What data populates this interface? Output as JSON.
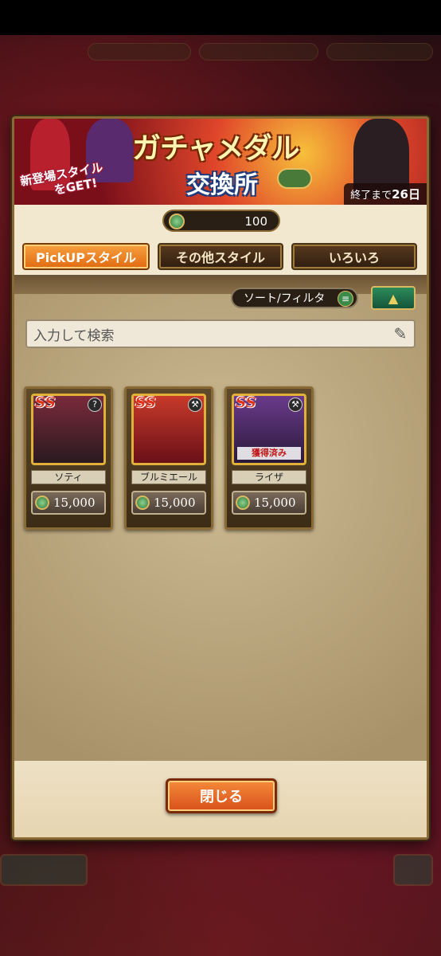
{
  "banner": {
    "title": "ガチャメダル",
    "subtitle": "交換所",
    "caption_line1": "新登場スタイル",
    "caption_line2": "をGET!",
    "end_label": "終了まで",
    "end_value": "26日"
  },
  "currency": {
    "value": "100",
    "icon": "medal-coin-icon"
  },
  "tabs": [
    {
      "label": "PickUPスタイル",
      "active": true
    },
    {
      "label": "その他スタイル",
      "active": false
    },
    {
      "label": "いろいろ",
      "active": false
    }
  ],
  "toolbar": {
    "sort_label": "ソート/フィルタ",
    "sort_icon": "list-icon",
    "toggle_icon": "triangle-up-icon"
  },
  "search": {
    "placeholder": "入力して検索",
    "icon": "edit-icon"
  },
  "items": [
    {
      "name": "ソティ",
      "price": "15,000",
      "rank": "SS",
      "owned": false
    },
    {
      "name": "ブルミエール",
      "price": "15,000",
      "rank": "SS",
      "owned": false
    },
    {
      "name": "ライザ",
      "price": "15,000",
      "rank": "SS",
      "owned_label": "獲得済み",
      "owned": true
    }
  ],
  "footer": {
    "close_label": "閉じる"
  },
  "colors": {
    "accent_orange": "#e06a10",
    "panel": "#f2e8cf",
    "frame": "#8a6a34"
  }
}
